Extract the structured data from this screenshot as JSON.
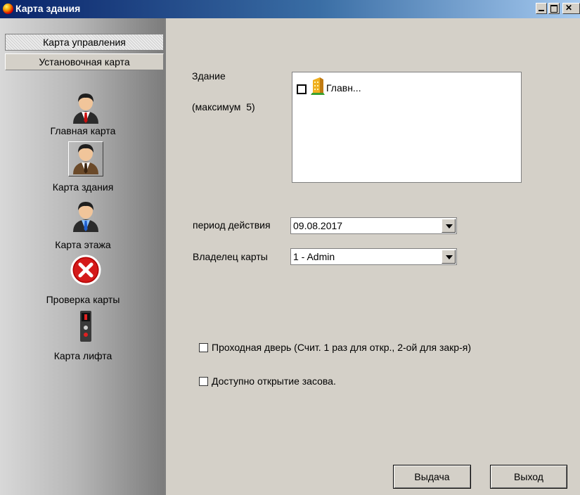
{
  "window": {
    "title": "Карта здания"
  },
  "sidebar": {
    "tabs": [
      {
        "label": "Карта управления"
      },
      {
        "label": "Установочная карта"
      }
    ],
    "items": [
      {
        "label": "Главная карта",
        "icon": "user-red-tie-icon"
      },
      {
        "label": "Карта здания",
        "icon": "user-brown-suit-icon",
        "selected": true
      },
      {
        "label": "Карта этажа",
        "icon": "user-blue-shirt-icon"
      },
      {
        "label": "Проверка карты",
        "icon": "red-x-icon"
      },
      {
        "label": "Карта лифта",
        "icon": "elevator-panel-icon"
      }
    ]
  },
  "form": {
    "building_label": "Здание",
    "building_hint": "(максимум  5)",
    "building_tree": [
      {
        "label": "Главн...",
        "checked": false,
        "icon": "building-icon"
      }
    ],
    "period_label": "период действия",
    "period_value": "09.08.2017",
    "owner_label": "Владелец карты",
    "owner_value": "1 - Admin",
    "passage_door_label": "Проходная дверь (Счит. 1 раз для откр., 2-ой для закр-я)",
    "passage_door_checked": false,
    "deadbolt_label": "Доступно открытие засова.",
    "deadbolt_checked": false
  },
  "buttons": {
    "issue": "Выдача",
    "exit": "Выход"
  },
  "colors": {
    "titlebar_start": "#0a246a",
    "titlebar_end": "#a6caf0",
    "panel": "#d4d0c8"
  }
}
